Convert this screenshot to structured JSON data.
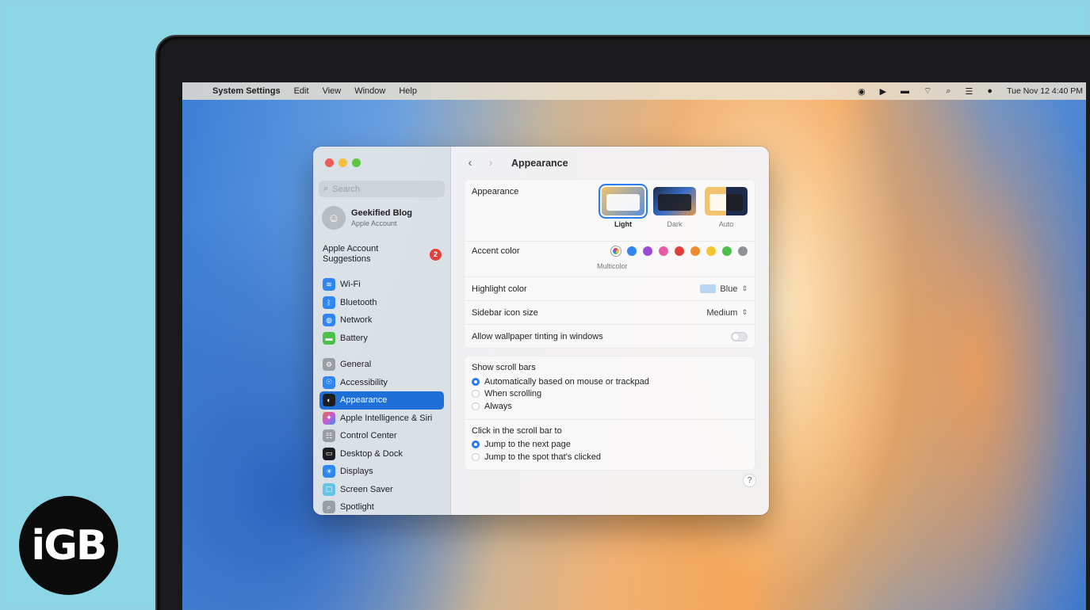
{
  "menubar": {
    "apple": "",
    "items": [
      "System Settings",
      "Edit",
      "View",
      "Window",
      "Help"
    ],
    "clock": "Tue Nov 12  4:40 PM"
  },
  "sidebar": {
    "search_placeholder": "Search",
    "account": {
      "name": "Geekified Blog",
      "subtitle": "Apple Account"
    },
    "suggestions": {
      "label": "Apple Account Suggestions",
      "badge": "2"
    },
    "network_items": [
      {
        "label": "Wi‑Fi",
        "icon": "wifi-icon"
      },
      {
        "label": "Bluetooth",
        "icon": "bluetooth-icon"
      },
      {
        "label": "Network",
        "icon": "globe-icon"
      },
      {
        "label": "Battery",
        "icon": "battery-icon"
      }
    ],
    "system_items": [
      {
        "label": "General",
        "icon": "gear-icon"
      },
      {
        "label": "Accessibility",
        "icon": "accessibility-icon"
      },
      {
        "label": "Appearance",
        "icon": "appearance-icon",
        "active": true
      },
      {
        "label": "Apple Intelligence & Siri",
        "icon": "siri-icon"
      },
      {
        "label": "Control Center",
        "icon": "control-center-icon"
      },
      {
        "label": "Desktop & Dock",
        "icon": "dock-icon"
      },
      {
        "label": "Displays",
        "icon": "sun-icon"
      },
      {
        "label": "Screen Saver",
        "icon": "screen-saver-icon"
      },
      {
        "label": "Spotlight",
        "icon": "spotlight-icon"
      }
    ]
  },
  "content": {
    "title": "Appearance",
    "appearance": {
      "label": "Appearance",
      "options": [
        {
          "label": "Light",
          "selected": true
        },
        {
          "label": "Dark",
          "selected": false
        },
        {
          "label": "Auto",
          "selected": false
        }
      ]
    },
    "accent": {
      "label": "Accent color",
      "selected_caption": "Multicolor",
      "colors": [
        "multicolor",
        "#2f86f0",
        "#9a4bd6",
        "#e65aa6",
        "#e0413a",
        "#f08a2c",
        "#f4c430",
        "#4cc04a",
        "#8e9296"
      ]
    },
    "highlight": {
      "label": "Highlight color",
      "value": "Blue"
    },
    "icon_size": {
      "label": "Sidebar icon size",
      "value": "Medium"
    },
    "tinting": {
      "label": "Allow wallpaper tinting in windows",
      "enabled": false
    },
    "scroll_bars": {
      "label": "Show scroll bars",
      "options": [
        {
          "label": "Automatically based on mouse or trackpad",
          "selected": true
        },
        {
          "label": "When scrolling",
          "selected": false
        },
        {
          "label": "Always",
          "selected": false
        }
      ]
    },
    "click_scroll": {
      "label": "Click in the scroll bar to",
      "options": [
        {
          "label": "Jump to the next page",
          "selected": true
        },
        {
          "label": "Jump to the spot that's clicked",
          "selected": false
        }
      ]
    },
    "help": "?"
  },
  "watermark": "iGB"
}
